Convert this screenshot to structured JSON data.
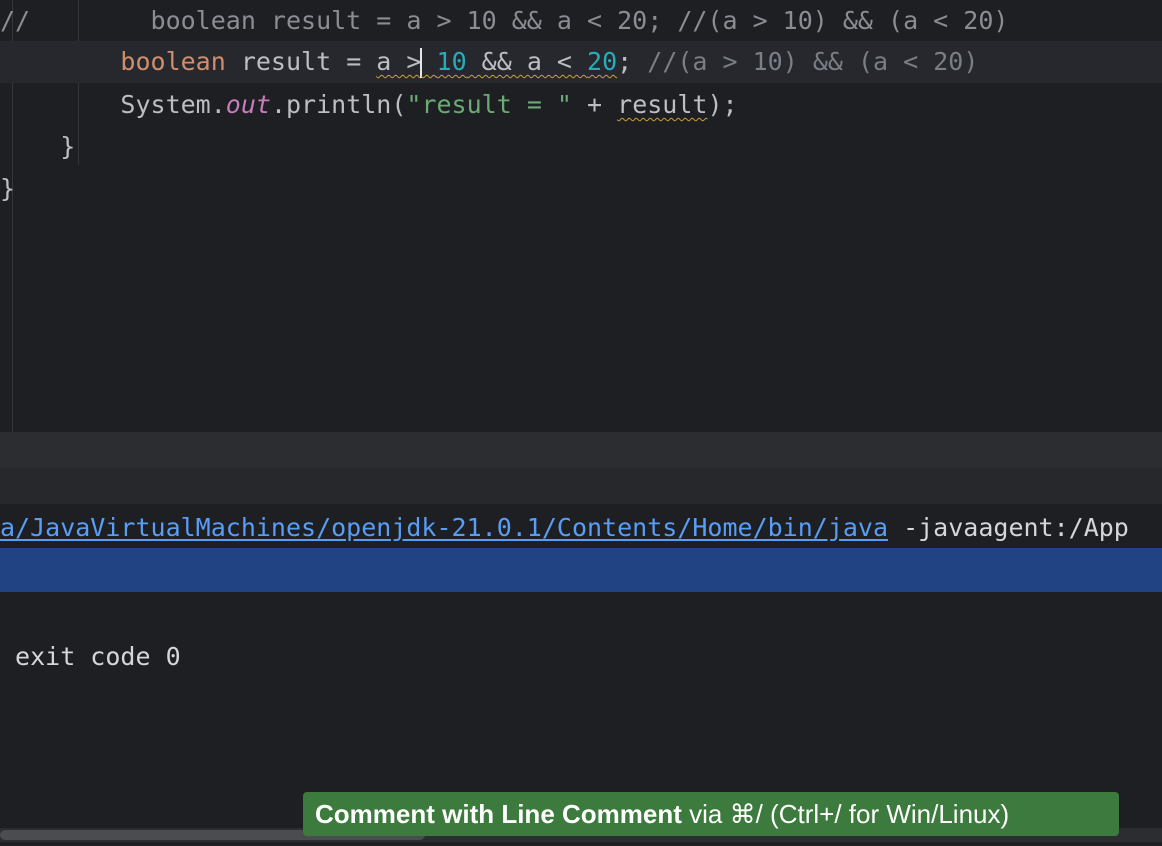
{
  "editor": {
    "lines": [
      {
        "comment_prefix": "//",
        "commented_code": "        boolean result = a > 10 && a < 20; //(a > 10) && (a < 20)"
      },
      {
        "indent": "        ",
        "kw": "boolean",
        "a1": " result = ",
        "expr_a": "a >",
        "expr_b": " ",
        "num1": "10",
        "expr_c": " && a < ",
        "num2": "20",
        "semi": ";",
        "comment": " //(a > 10) && (a < 20)"
      },
      {
        "indent": "        ",
        "sys": "System.",
        "field": "out",
        "call": ".println(",
        "str": "\"result = \"",
        "plus": " + ",
        "var": "result",
        "end": ");"
      },
      {
        "text": "    }"
      },
      {
        "text": "}"
      }
    ]
  },
  "console": {
    "path_link": "a/JavaVirtualMachines/openjdk-21.0.1/Contents/Home/bin/java",
    "args": " -javaagent:/App",
    "exit_line": " exit code 0"
  },
  "hint": {
    "action": "Comment with Line Comment",
    "shortcut": " via ⌘/ (Ctrl+/ for Win/Linux)"
  },
  "colors": {
    "background": "#1e1f22",
    "keyword": "#cf8e6d",
    "number": "#2aacb8",
    "string": "#6aab73",
    "link": "#589df6",
    "selection": "#214283",
    "hint_bg": "#3d7a3d"
  }
}
